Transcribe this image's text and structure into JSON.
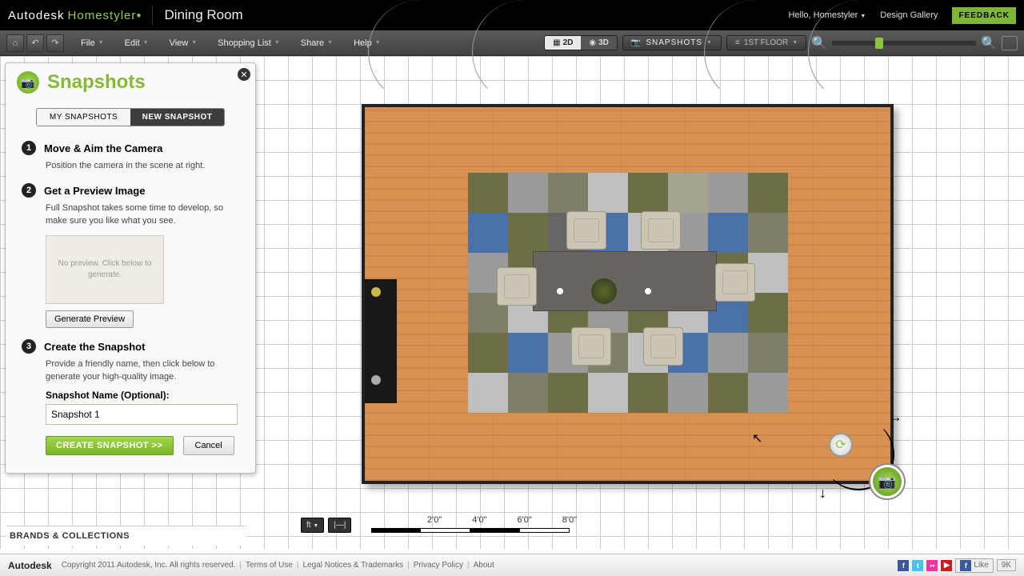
{
  "header": {
    "logo1": "Autodesk",
    "logo2": "Homestyler",
    "project": "Dining Room",
    "hello": "Hello, Homestyler",
    "gallery": "Design Gallery",
    "feedback": "FEEDBACK"
  },
  "menubar": {
    "items": [
      "File",
      "Edit",
      "View",
      "Shopping List",
      "Share",
      "Help"
    ],
    "view2d": "2D",
    "view3d": "3D",
    "snapshots": "SNAPSHOTS",
    "floor": "1ST FLOOR"
  },
  "panel": {
    "title": "Snapshots",
    "tab_my": "MY SNAPSHOTS",
    "tab_new": "NEW SNAPSHOT",
    "step1_h": "Move & Aim the Camera",
    "step1_p": "Position the camera in the scene at right.",
    "step2_h": "Get a Preview Image",
    "step2_p": "Full Snapshot takes some time to develop, so make sure you like what you see.",
    "preview_empty": "No preview. Click below to generate.",
    "gen_btn": "Generate Preview",
    "step3_h": "Create the Snapshot",
    "step3_p": "Provide a friendly name, then click below to generate your high-quality image.",
    "name_label": "Snapshot Name (Optional):",
    "name_value": "Snapshot 1",
    "create_btn": "CREATE SNAPSHOT >>",
    "cancel_btn": "Cancel"
  },
  "brands": "BRANDS & COLLECTIONS",
  "scale": {
    "unit_btn": "ft",
    "labels": [
      "2'0\"",
      "4'0\"",
      "6'0\"",
      "8'0\""
    ]
  },
  "footer": {
    "brand": "Autodesk",
    "copy": "Copyright 2011 Autodesk, Inc. All rights reserved.",
    "links": [
      "Terms of Use",
      "Legal Notices & Trademarks",
      "Privacy Policy",
      "About"
    ],
    "like": "Like",
    "like_count": "9K"
  },
  "rug_colors": [
    [
      "#6e6e46",
      "#9a9a9a",
      "#7e7f66",
      "#bfbfbf",
      "#6e6e46",
      "#a5a58f",
      "#9a9a9a",
      "#6e6e46"
    ],
    [
      "#4a72a8",
      "#6e6e46",
      "#666666",
      "#4a72a8",
      "#bfbfbf",
      "#9a9a9a",
      "#4a72a8",
      "#7e7f66"
    ],
    [
      "#9a9a9a",
      "#6e6e46",
      "#bfbfbf",
      "#6e6e46",
      "#7e7f66",
      "#4a72a8",
      "#6e6e46",
      "#bfbfbf"
    ],
    [
      "#7e7f66",
      "#bfbfbf",
      "#6e6e46",
      "#9a9a9a",
      "#6e6e46",
      "#bfbfbf",
      "#4a72a8",
      "#6e6e46"
    ],
    [
      "#6e6e46",
      "#4a72a8",
      "#9a9a9a",
      "#7e7f66",
      "#bfbfbf",
      "#4a72a8",
      "#9a9a9a",
      "#7e7f66"
    ],
    [
      "#bfbfbf",
      "#7e7f66",
      "#6e6e46",
      "#bfbfbf",
      "#6e6e46",
      "#9a9a9a",
      "#6e6e46",
      "#9a9a9a"
    ]
  ]
}
